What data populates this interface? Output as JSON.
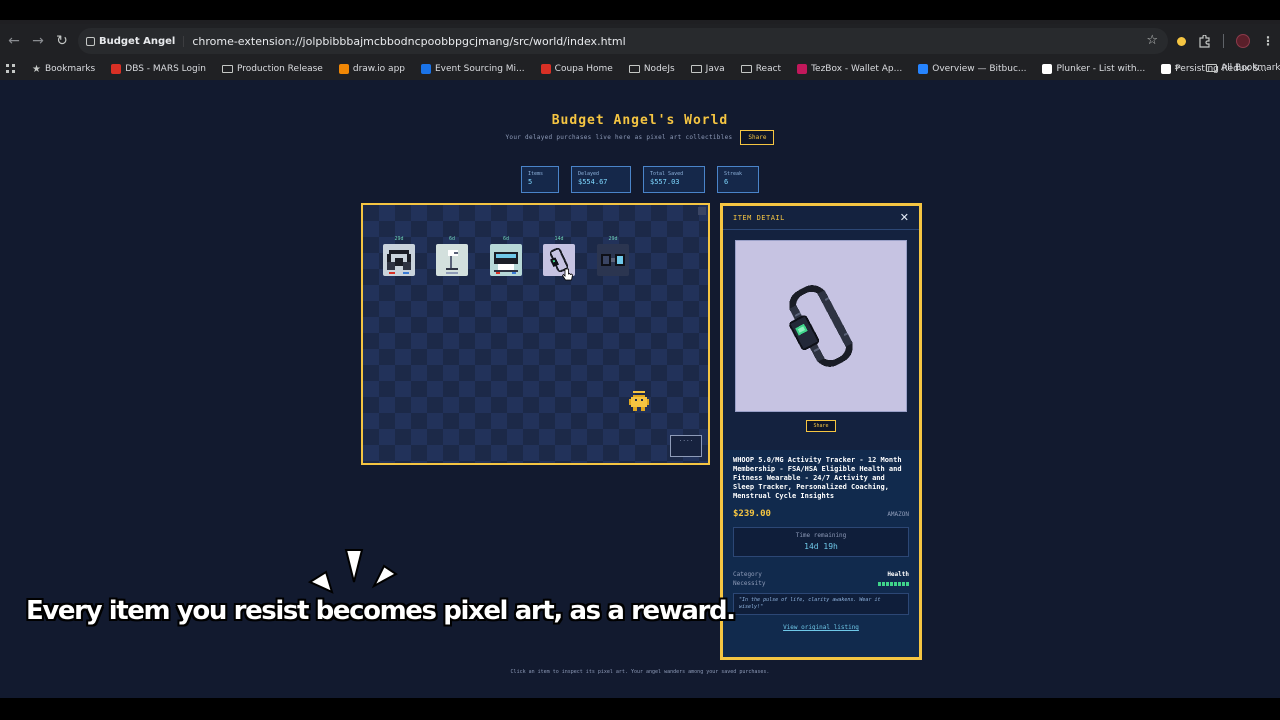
{
  "browser": {
    "tab_title": "Budget Angel",
    "url": "chrome-extension://jolpbibbbajmcbbodncpoobbpgcjmang/src/world/index.html",
    "bookmarks": [
      {
        "label": "Bookmarks",
        "icon": "star-icon",
        "color": "#c4c7c5"
      },
      {
        "label": "DBS - MARS Login",
        "icon": "dbs-icon",
        "color": "#d93025"
      },
      {
        "label": "Production Release",
        "icon": "folder-icon",
        "color": ""
      },
      {
        "label": "draw.io app",
        "icon": "drawio-icon",
        "color": "#f08705"
      },
      {
        "label": "Event Sourcing Mi...",
        "icon": "gear-icon",
        "color": "#1a73e8"
      },
      {
        "label": "Coupa Home",
        "icon": "coupa-icon",
        "color": "#d93025"
      },
      {
        "label": "NodeJs",
        "icon": "folder-icon",
        "color": ""
      },
      {
        "label": "Java",
        "icon": "folder-icon",
        "color": ""
      },
      {
        "label": "React",
        "icon": "folder-icon",
        "color": ""
      },
      {
        "label": "TezBox - Wallet Ap...",
        "icon": "tezbox-icon",
        "color": "#c2185b"
      },
      {
        "label": "Overview — Bitbuc...",
        "icon": "bitbucket-icon",
        "color": "#2684ff"
      },
      {
        "label": "Plunker - List with...",
        "icon": "plunker-icon",
        "color": "#ffffff"
      },
      {
        "label": "Persisting Redux S...",
        "icon": "medium-icon",
        "color": "#ffffff"
      }
    ],
    "all_bookmarks": "All Bookmarks"
  },
  "page": {
    "title": "Budget Angel's World",
    "subtitle": "Your delayed purchases live here as pixel art collectibles",
    "share_label": "Share",
    "stats": [
      {
        "label": "Items",
        "value": "5"
      },
      {
        "label": "Delayed",
        "value": "$554.67"
      },
      {
        "label": "Total Saved",
        "value": "$557.03"
      },
      {
        "label": "Streak",
        "value": "6"
      }
    ],
    "world_items": [
      {
        "days": "29d",
        "name": "headphones",
        "bg": "#c9d3dc"
      },
      {
        "days": "6d",
        "name": "desk-lamp",
        "bg": "#d3e0dd"
      },
      {
        "days": "6d",
        "name": "printer",
        "bg": "#b7d8d7"
      },
      {
        "days": "14d",
        "name": "fitness-band",
        "bg": "#c6c3e2"
      },
      {
        "days": "29d",
        "name": "smartwatch",
        "bg": "#2b3550"
      }
    ],
    "minimap_label": "....",
    "footer_hint": "Click an item to inspect its pixel art. Your angel wanders among your saved purchases."
  },
  "detail": {
    "header": "ITEM DETAIL",
    "share_label": "Share",
    "name": "WHOOP 5.0/MG Activity Tracker - 12 Month Membership - FSA/HSA Eligible Health and Fitness Wearable - 24/7 Activity and Sleep Tracker, Personalized Coaching, Menstrual Cycle Insights",
    "price": "$239.00",
    "merchant": "AMAZON",
    "time_remaining_label": "Time remaining",
    "time_remaining": "14d 19h",
    "category_label": "Category",
    "category": "Health",
    "necessity_label": "Necessity",
    "necessity_level": 8,
    "quote": "\"In the pulse of life, clarity awakens. Wear it wisely!\"",
    "view_link": "View original listing"
  },
  "caption": "Every item you resist becomes pixel art, as a reward."
}
